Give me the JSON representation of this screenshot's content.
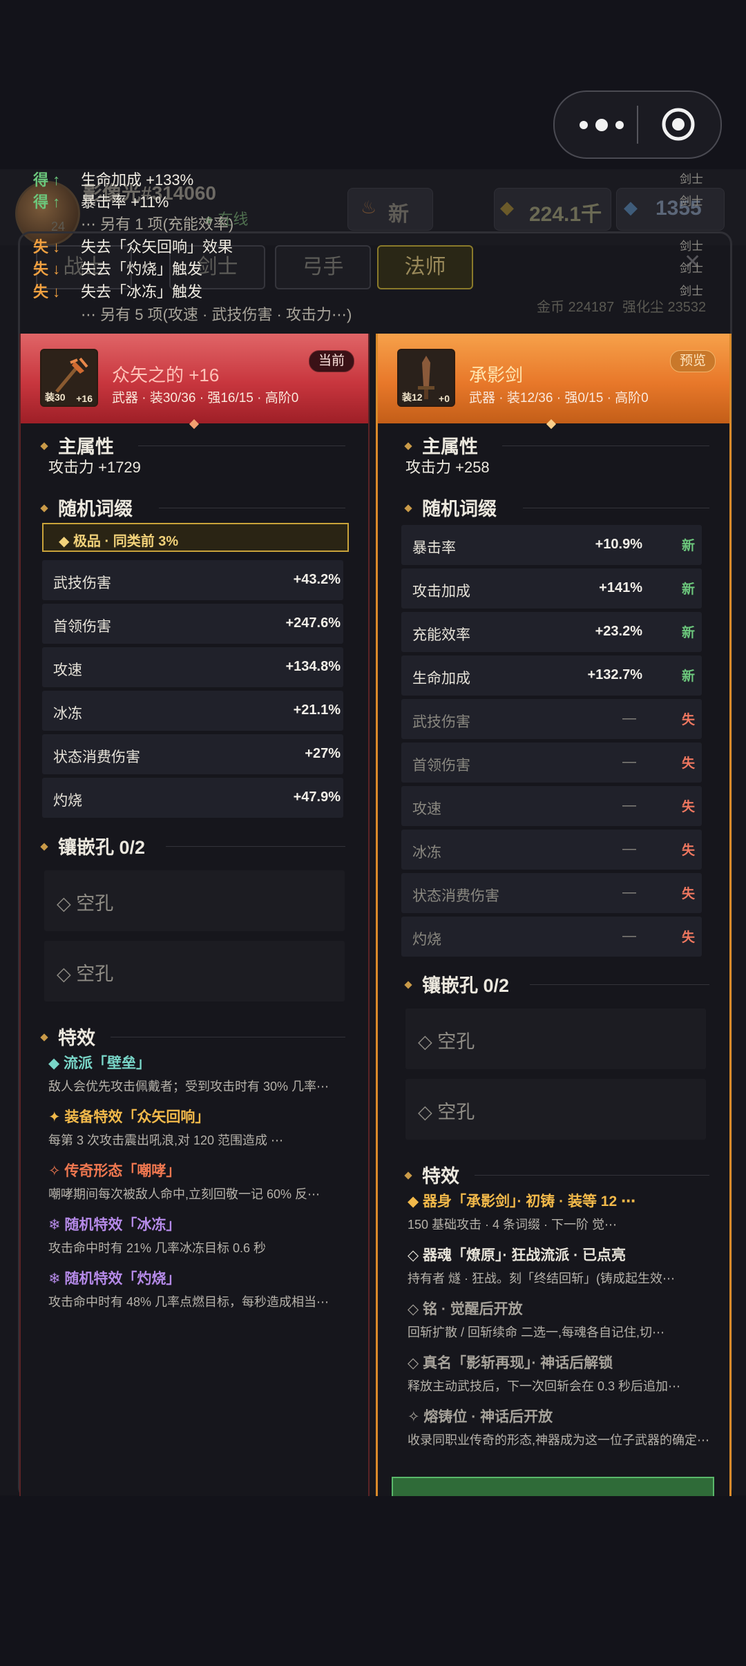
{
  "background": {
    "player_name": "影像光#314060",
    "online": "在线",
    "level_badge": "24",
    "new_label": "新",
    "gold": "224.1千",
    "gems": "1355",
    "tabs": [
      "战士",
      "剑士",
      "弓手",
      "法师"
    ],
    "currency": "金币 224187",
    "dust": "强化尘 23532"
  },
  "log": {
    "rows": [
      {
        "tag": "得 ↑",
        "text": "生命加成 +133%",
        "right": "剑士",
        "kind": "gain"
      },
      {
        "tag": "得 ↑",
        "text": "暴击率 +11%",
        "right": "剑士",
        "kind": "gain"
      },
      {
        "tag": "",
        "text": "⋯ 另有 1 项(充能效率)",
        "right": "",
        "kind": "more"
      },
      {
        "tag": "失 ↓",
        "text": "失去「众矢回响」效果",
        "right": "剑士",
        "kind": "loss"
      },
      {
        "tag": "失 ↓",
        "text": "失去「灼烧」触发",
        "right": "剑士",
        "kind": "loss"
      },
      {
        "tag": "失 ↓",
        "text": "失去「冰冻」触发",
        "right": "剑士",
        "kind": "loss"
      },
      {
        "tag": "",
        "text": "⋯ 另有 5 项(攻速 · 武技伤害 · 攻击力⋯)",
        "right": "",
        "kind": "more"
      }
    ]
  },
  "left": {
    "name": "众矢之的 +16",
    "sub": "武器 · 装30/36 · 强16/15 · 高阶0",
    "badge": "当前",
    "item_lv": "装30",
    "item_plus": "+16",
    "main_title": "主属性",
    "main_attr": "攻击力 +1729",
    "random_title": "随机词缀",
    "rare": "◆ 极品 · 同类前 3%",
    "rows": [
      {
        "k": "武技伤害",
        "v": "+43.2%"
      },
      {
        "k": "首领伤害",
        "v": "+247.6%"
      },
      {
        "k": "攻速",
        "v": "+134.8%"
      },
      {
        "k": "冰冻",
        "v": "+21.1%"
      },
      {
        "k": "状态消费伤害",
        "v": "+27%"
      },
      {
        "k": "灼烧",
        "v": "+47.9%"
      }
    ],
    "socket_title": "镶嵌孔 0/2",
    "slots": [
      "◇ 空孔",
      "◇ 空孔"
    ],
    "fx_title": "特效",
    "fx": [
      {
        "title": "◆ 流派「壁垒」",
        "desc": "敌人会优先攻击佩戴者；受到攻击时有 30% 几率⋯",
        "color": "#79d6c8"
      },
      {
        "title": "✦ 装备特效「众矢回响」",
        "desc": "每第 3 次攻击震出吼浪,对 120 范围造成 ⋯",
        "color": "#f2b94a"
      },
      {
        "title": "✧ 传奇形态「嘲哮」",
        "desc": "嘲哮期间每次被敌人命中,立刻回敬一记 60% 反⋯",
        "color": "#f07850"
      },
      {
        "title": "❄ 随机特效「冰冻」",
        "desc": "攻击命中时有 21% 几率冰冻目标 0.6 秒",
        "color": "#b58ae8"
      },
      {
        "title": "❄ 随机特效「灼烧」",
        "desc": "攻击命中时有 48% 几率点燃目标，每秒造成相当⋯",
        "color": "#b58ae8"
      }
    ]
  },
  "right": {
    "name": "承影剑",
    "sub": "武器 · 装12/36 · 强0/15 · 高阶0",
    "badge": "预览",
    "item_lv": "装12",
    "item_plus": "+0",
    "main_title": "主属性",
    "main_attr": "攻击力 +258",
    "random_title": "随机词缀",
    "rows": [
      {
        "k": "暴击率",
        "v": "+10.9%",
        "t": "新",
        "lost": false
      },
      {
        "k": "攻击加成",
        "v": "+141%",
        "t": "新",
        "lost": false
      },
      {
        "k": "充能效率",
        "v": "+23.2%",
        "t": "新",
        "lost": false
      },
      {
        "k": "生命加成",
        "v": "+132.7%",
        "t": "新",
        "lost": false
      },
      {
        "k": "武技伤害",
        "v": "—",
        "t": "失",
        "lost": true
      },
      {
        "k": "首领伤害",
        "v": "—",
        "t": "失",
        "lost": true
      },
      {
        "k": "攻速",
        "v": "—",
        "t": "失",
        "lost": true
      },
      {
        "k": "冰冻",
        "v": "—",
        "t": "失",
        "lost": true
      },
      {
        "k": "状态消费伤害",
        "v": "—",
        "t": "失",
        "lost": true
      },
      {
        "k": "灼烧",
        "v": "—",
        "t": "失",
        "lost": true
      }
    ],
    "socket_title": "镶嵌孔 0/2",
    "slots": [
      "◇ 空孔",
      "◇ 空孔"
    ],
    "fx_title": "特效",
    "fx": [
      {
        "title": "◆ 器身「承影剑」· 初铸 · 装等 12 ⋯",
        "desc": "150 基础攻击 · 4 条词缀 · 下一阶 觉⋯",
        "color": "#f2b94a"
      },
      {
        "title": "◇ 器魂「燎原」· 狂战流派 · 已点亮",
        "desc": "持有者 燧 · 狂战。刻「终结回斩」(铸成起生效⋯",
        "color": "#e6e2d8"
      },
      {
        "title": "◇ 铭 · 觉醒后开放",
        "desc": "回斩扩散 / 回斩续命 二选一,每魂各自记住,切⋯",
        "color": "#a6a29a"
      },
      {
        "title": "◇ 真名「影斩再现」· 神话后解锁",
        "desc": "释放主动武技后，下一次回斩会在 0.3 秒后追加⋯",
        "color": "#a6a29a"
      },
      {
        "title": "✧ 熔铸位 · 神话后开放",
        "desc": "收录同职业传奇的形态,神器成为这一位子武器的确定⋯",
        "color": "#a6a29a"
      }
    ]
  },
  "colors": {
    "gain": "#6cc77c",
    "loss": "#f0a040",
    "new": "#6cc77c",
    "lost": "#f07860",
    "gold": "#c99a48"
  }
}
